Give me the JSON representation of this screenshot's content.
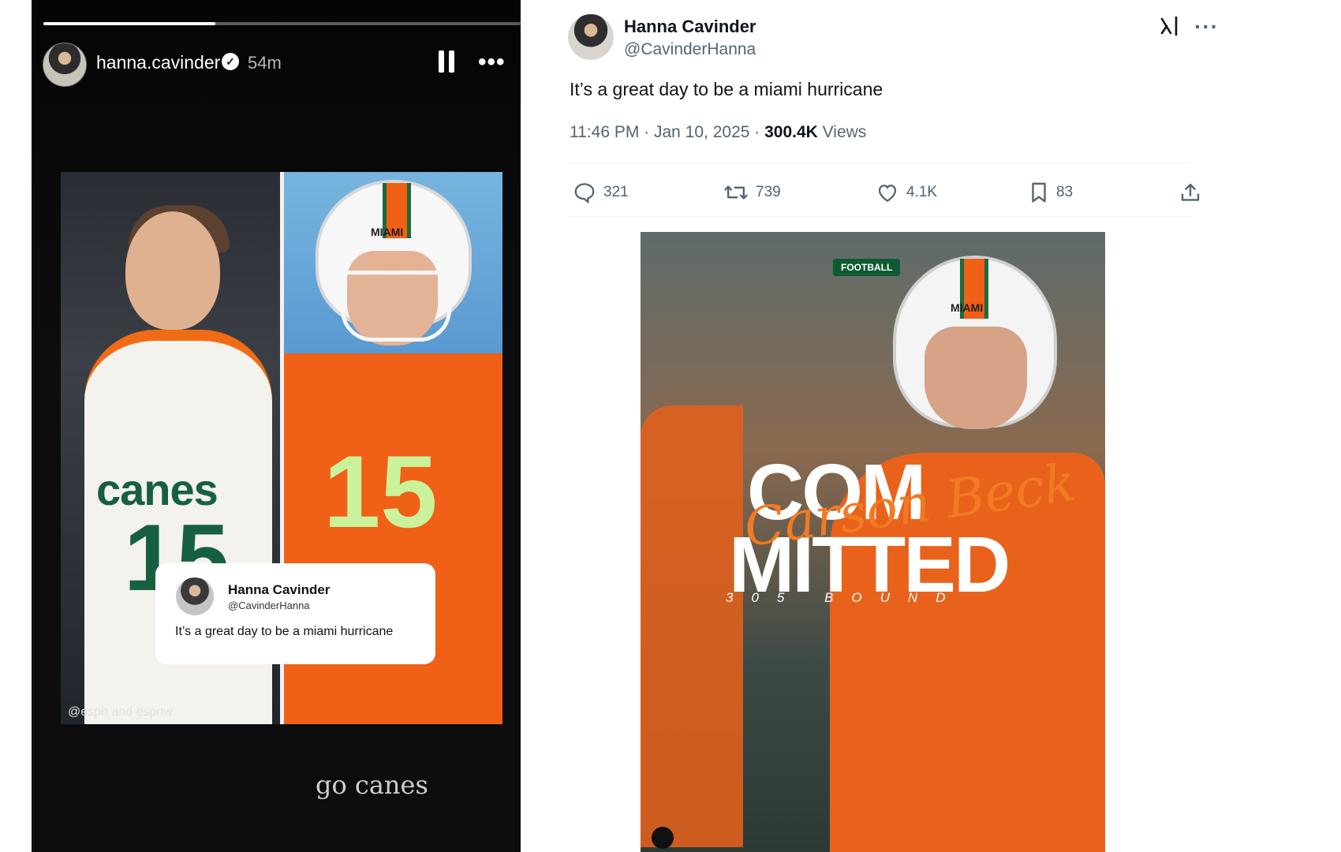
{
  "story": {
    "progress": 0.36,
    "username": "hanna.cavinder",
    "time": "54m",
    "card": {
      "name": "Hanna Cavinder",
      "handle": "@CavinderHanna",
      "text": "It’s a great day to be a miami hurricane"
    },
    "photo_text": {
      "left_jersey_word": "canes",
      "left_jersey_number": "15",
      "right_helmet": "MIAMI",
      "right_jersey_number": "15"
    },
    "credit": "@espn and espnw",
    "caption": "go canes"
  },
  "tweet": {
    "name": "Hanna Cavinder",
    "handle": "@CavinderHanna",
    "text": "It’s a great day to be a miami hurricane",
    "timestamp": "11:46 PM · Jan 10, 2025 ·",
    "views_count": "300.4K",
    "views_label": "Views",
    "actions": {
      "replies": "321",
      "reposts": "739",
      "likes": "4.1K",
      "bookmarks": "83"
    },
    "image": {
      "badge": "FOOTBALL",
      "helmet": "MIAMI",
      "headline_top": "COM",
      "headline_bottom": "MITTED",
      "script_name": "Carson Beck",
      "tagline": "305 BOUND"
    }
  },
  "colors": {
    "story_bg": "#0d0d0f",
    "x_text": "#0f1419",
    "x_muted": "#536471",
    "canes_orange": "#f06016",
    "canes_green": "#1b6b3d"
  }
}
